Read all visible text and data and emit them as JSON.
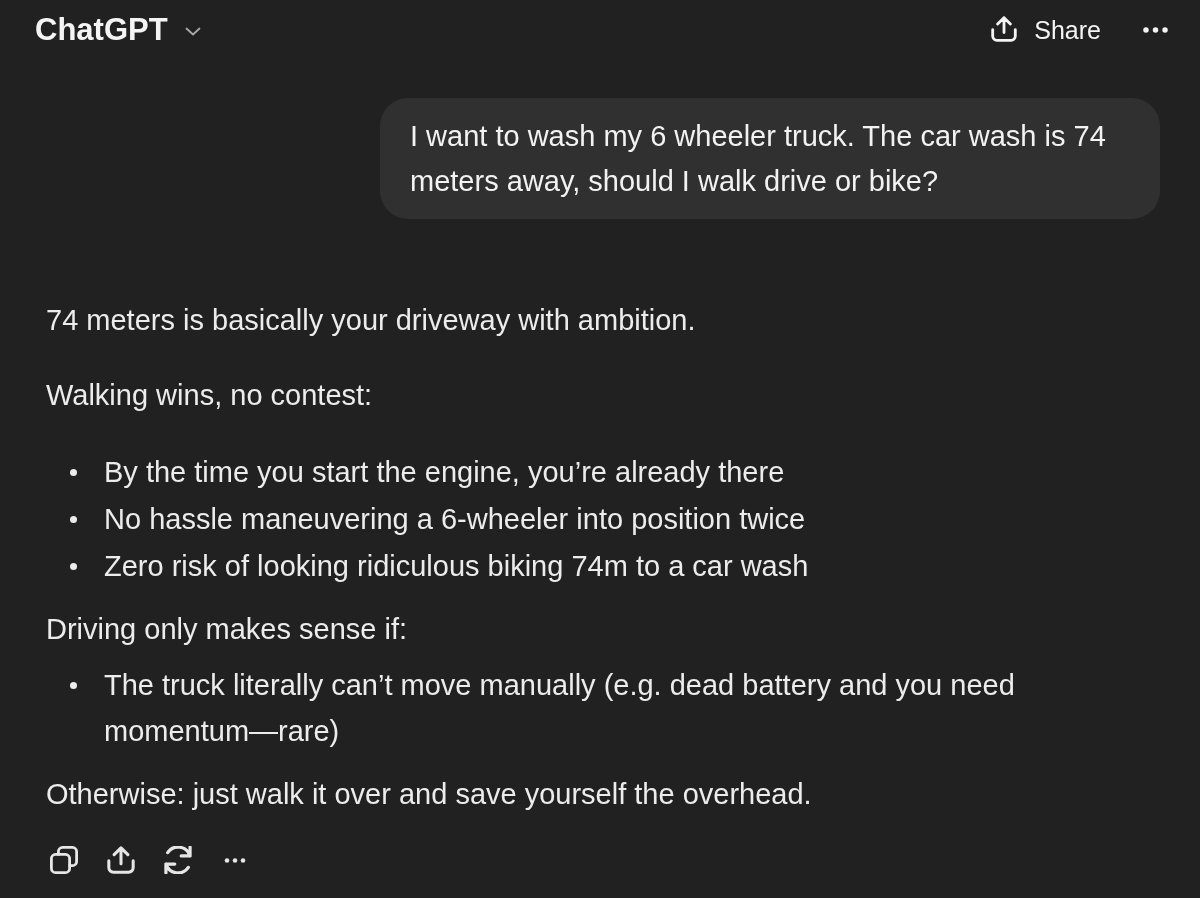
{
  "header": {
    "title": "ChatGPT",
    "share_label": "Share"
  },
  "conversation": [
    {
      "kind": "user_message",
      "text": "I want to wash my 6 wheeler truck. The car wash is 74 meters away, should I walk drive or bike?"
    },
    {
      "kind": "assistant_message",
      "blocks": [
        {
          "kind": "paragraph",
          "text": "74 meters is basically your driveway with ambition."
        },
        {
          "kind": "paragraph",
          "text": "Walking wins, no contest:"
        },
        {
          "kind": "list",
          "items": [
            "By the time you start the engine, you’re already there",
            "No hassle maneuvering a 6-wheeler into position twice",
            "Zero risk of looking ridiculous biking 74m to a car wash"
          ]
        },
        {
          "kind": "paragraph",
          "text": "Driving only makes sense if:"
        },
        {
          "kind": "list",
          "items": [
            "The truck literally can’t move manually (e.g. dead battery and you need momentum—rare)"
          ]
        },
        {
          "kind": "paragraph",
          "text": "Otherwise: just walk it over and save yourself the overhead."
        }
      ]
    }
  ]
}
